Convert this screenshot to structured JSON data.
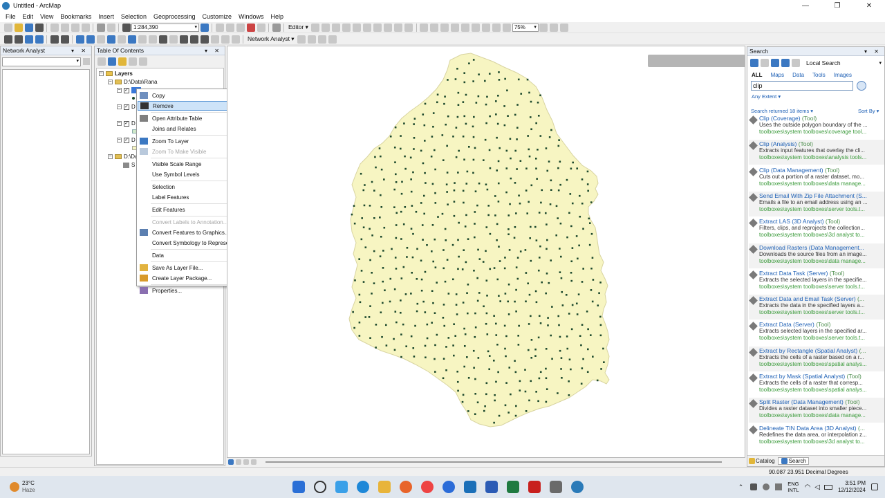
{
  "window": {
    "title": "Untitled - ArcMap",
    "controls": [
      "—",
      "❐",
      "✕"
    ]
  },
  "menu": [
    "File",
    "Edit",
    "View",
    "Bookmarks",
    "Insert",
    "Selection",
    "Geoprocessing",
    "Customize",
    "Windows",
    "Help"
  ],
  "toolbar": {
    "scale": "1:284,390",
    "editor_label": "Editor ▾",
    "network_analyst_label": "Network Analyst ▾",
    "zoom_percent": "75%"
  },
  "network_analyst_panel": {
    "title": "Network Analyst"
  },
  "toc": {
    "title": "Table Of Contents",
    "pins": "▾ ✕",
    "layers_label": "Layers",
    "groups": [
      {
        "path": "D:\\Data\\Rana"
      },
      {
        "path": "D:\\Data"
      }
    ],
    "truncated_items": [
      "D",
      "D",
      "D",
      "S"
    ]
  },
  "context_menu": {
    "items": [
      {
        "label": "Copy",
        "enabled": true,
        "submenu": false,
        "highlighted": false,
        "icon_color": "#6f8fbf"
      },
      {
        "label": "Remove",
        "enabled": true,
        "submenu": false,
        "highlighted": true,
        "icon_color": "#333333"
      },
      {
        "label": "Open Attribute Table",
        "enabled": true,
        "submenu": false,
        "highlighted": false,
        "icon_color": "#7f7f7f"
      },
      {
        "label": "Joins and Relates",
        "enabled": true,
        "submenu": true,
        "highlighted": false,
        "icon_color": ""
      },
      {
        "label": "Zoom To Layer",
        "enabled": true,
        "submenu": false,
        "highlighted": false,
        "icon_color": "#3b78c2"
      },
      {
        "label": "Zoom To Make Visible",
        "enabled": false,
        "submenu": false,
        "highlighted": false,
        "icon_color": "#b9c9dc"
      },
      {
        "label": "Visible Scale Range",
        "enabled": true,
        "submenu": true,
        "highlighted": false,
        "icon_color": ""
      },
      {
        "label": "Use Symbol Levels",
        "enabled": true,
        "submenu": false,
        "highlighted": false,
        "icon_color": ""
      },
      {
        "label": "Selection",
        "enabled": true,
        "submenu": true,
        "highlighted": false,
        "icon_color": ""
      },
      {
        "label": "Label Features",
        "enabled": true,
        "submenu": false,
        "highlighted": false,
        "icon_color": ""
      },
      {
        "label": "Edit Features",
        "enabled": true,
        "submenu": true,
        "highlighted": false,
        "icon_color": ""
      },
      {
        "label": "Convert Labels to Annotation...",
        "enabled": false,
        "submenu": false,
        "highlighted": false,
        "icon_color": ""
      },
      {
        "label": "Convert Features to Graphics...",
        "enabled": true,
        "submenu": false,
        "highlighted": false,
        "icon_color": "#5b7fb0"
      },
      {
        "label": "Convert Symbology to Representation...",
        "enabled": true,
        "submenu": false,
        "highlighted": false,
        "icon_color": ""
      },
      {
        "label": "Data",
        "enabled": true,
        "submenu": true,
        "highlighted": false,
        "icon_color": ""
      },
      {
        "label": "Save As Layer File...",
        "enabled": true,
        "submenu": false,
        "highlighted": false,
        "icon_color": "#e2b33f"
      },
      {
        "label": "Create Layer Package...",
        "enabled": true,
        "submenu": false,
        "highlighted": false,
        "icon_color": "#d89a2a"
      },
      {
        "label": "Properties...",
        "enabled": true,
        "submenu": false,
        "highlighted": false,
        "icon_color": "#8a6fb0"
      }
    ]
  },
  "map": {
    "polygon_fill": "#f7f5c2",
    "point_color": "#1e4a2e"
  },
  "search": {
    "title": "Search",
    "pins": "▾ ✕",
    "mode": "Local Search",
    "tabs": [
      "ALL",
      "Maps",
      "Data",
      "Tools",
      "Images"
    ],
    "query": "clip",
    "extent": "Any Extent ▾",
    "results_count": "Search returned 18 items ▾",
    "sort": "Sort By ▾",
    "results": [
      {
        "title": "Clip (Coverage)",
        "kind": "(Tool)",
        "desc": "Uses the outside polygon boundary of the ...",
        "path": "toolboxes\\system toolboxes\\coverage tool..."
      },
      {
        "title": "Clip (Analysis)",
        "kind": "(Tool)",
        "desc": "Extracts input features that overlay the cli...",
        "path": "toolboxes\\system toolboxes\\analysis tools..."
      },
      {
        "title": "Clip (Data Management)",
        "kind": "(Tool)",
        "desc": "Cuts out a portion of a raster dataset, mo...",
        "path": "toolboxes\\system toolboxes\\data manage..."
      },
      {
        "title": "Send Email With Zip File Attachment (S...",
        "kind": "",
        "desc": "Emails a file to an email address using an ...",
        "path": "toolboxes\\system toolboxes\\server tools.t..."
      },
      {
        "title": "Extract LAS (3D Analyst)",
        "kind": "(Tool)",
        "desc": "Filters, clips, and reprojects the collection...",
        "path": "toolboxes\\system toolboxes\\3d analyst to..."
      },
      {
        "title": "Download Rasters (Data Management...",
        "kind": "",
        "desc": "Downloads the source files from an image...",
        "path": "toolboxes\\system toolboxes\\data manage..."
      },
      {
        "title": "Extract Data Task (Server)",
        "kind": "(Tool)",
        "desc": "Extracts the selected layers in the specifie...",
        "path": "toolboxes\\system toolboxes\\server tools.t..."
      },
      {
        "title": "Extract Data and Email Task (Server)",
        "kind": "(...",
        "desc": "Extracts the data in the specified layers a...",
        "path": "toolboxes\\system toolboxes\\server tools.t..."
      },
      {
        "title": "Extract Data (Server)",
        "kind": "(Tool)",
        "desc": "Extracts selected layers in the specified ar...",
        "path": "toolboxes\\system toolboxes\\server tools.t..."
      },
      {
        "title": "Extract by Rectangle (Spatial Analyst)",
        "kind": "(...",
        "desc": "Extracts the cells of a raster based on a r...",
        "path": "toolboxes\\system toolboxes\\spatial analys..."
      },
      {
        "title": "Extract by Mask (Spatial Analyst)",
        "kind": "(Tool)",
        "desc": "Extracts the cells of a raster that corresp...",
        "path": "toolboxes\\system toolboxes\\spatial analys..."
      },
      {
        "title": "Split Raster (Data Management)",
        "kind": "(Tool)",
        "desc": "Divides a raster dataset into smaller piece...",
        "path": "toolboxes\\system toolboxes\\data manage..."
      },
      {
        "title": "Delineate TIN Data Area (3D Analyst)",
        "kind": "(...",
        "desc": "Redefines the data area, or interpolation z...",
        "path": "toolboxes\\system toolboxes\\3d analyst to..."
      }
    ],
    "bottom_tabs": [
      "Catalog",
      "Search"
    ]
  },
  "status": {
    "coords": "90.087  23.951 Decimal Degrees"
  },
  "taskbar": {
    "weather_temp": "23°C",
    "weather_desc": "Haze",
    "lang_top": "ENG",
    "lang_bottom": "INTL",
    "time": "3:51 PM",
    "date": "12/12/2024"
  }
}
